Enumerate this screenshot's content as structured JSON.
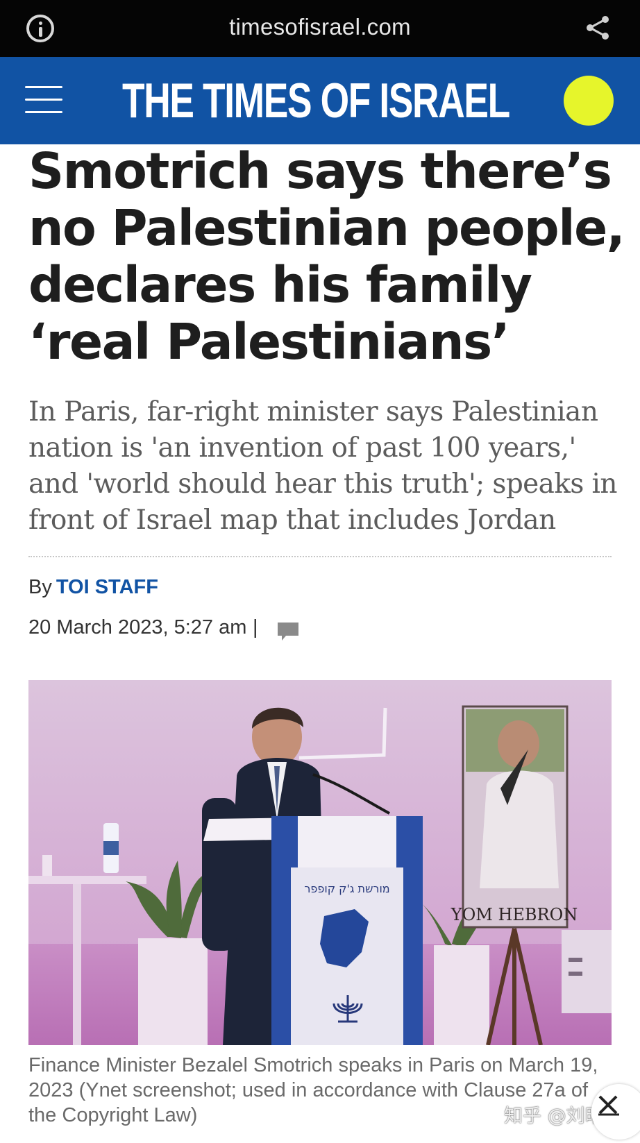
{
  "browser": {
    "url": "timesofisrael.com",
    "info_icon": "info-icon",
    "share_icon": "share-icon"
  },
  "masthead": {
    "logo_text": "THE TIMES OF ISRAEL",
    "menu_icon": "hamburger-menu-icon",
    "background_color": "#1153a4",
    "accent_dot_color": "#e6f52b"
  },
  "article": {
    "headline": "Smotrich says there’s no Palestinian people, declares his family ‘real Palestinians’",
    "deck": "In Paris, far-right minister says Palestinian nation is 'an invention of past 100 years,' and 'world should hear this truth'; speaks in front of Israel map that includes Jordan",
    "byline_prefix": "By",
    "author": "TOI STAFF",
    "date": "20 March 2023, 5:27 am",
    "separator": "|",
    "comment_icon": "comment-icon",
    "photo": {
      "lectern_text": "מורשת ג'ק קופפר",
      "poster_text": "YOM HEBRON"
    },
    "caption": "Finance Minister Bezalel Smotrich speaks in Paris on March 19, 2023 (Ynet screenshot; used in accordance with Clause 27a of the Copyright Law)"
  },
  "overlay": {
    "watermark": "知乎 @刘昭廷",
    "close_icon": "close-collapse-icon"
  }
}
